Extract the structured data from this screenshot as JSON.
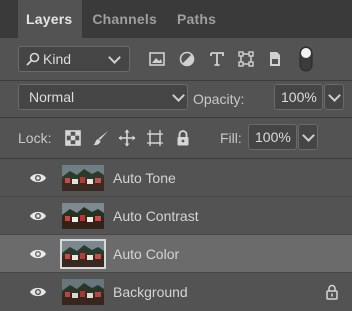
{
  "tabs": [
    {
      "label": "Layers",
      "active": true
    },
    {
      "label": "Channels",
      "active": false
    },
    {
      "label": "Paths",
      "active": false
    }
  ],
  "filter": {
    "kind_label": "Kind",
    "icons": [
      "pixel-layer-filter-icon",
      "adjustment-layer-filter-icon",
      "type-layer-filter-icon",
      "shape-layer-filter-icon",
      "smart-object-filter-icon",
      "filter-toggle-icon"
    ]
  },
  "blend": {
    "mode": "Normal",
    "opacity_label": "Opacity:",
    "opacity_value": "100%"
  },
  "lock": {
    "label": "Lock:",
    "icons": [
      "lock-transparent-pixels-icon",
      "lock-image-pixels-icon",
      "lock-position-icon",
      "lock-artboard-icon",
      "lock-all-icon"
    ],
    "fill_label": "Fill:",
    "fill_value": "100%"
  },
  "layers": [
    {
      "name": "Auto Tone",
      "selected": false,
      "locked": false
    },
    {
      "name": "Auto Contrast",
      "selected": false,
      "locked": false
    },
    {
      "name": "Auto Color",
      "selected": true,
      "locked": false
    },
    {
      "name": "Background",
      "selected": false,
      "locked": true
    }
  ],
  "colors": {
    "panel_bg": "#535353",
    "tabbar_bg": "#3a3a3a",
    "selected_row": "#6b6b6b",
    "field_bg": "#454545"
  }
}
